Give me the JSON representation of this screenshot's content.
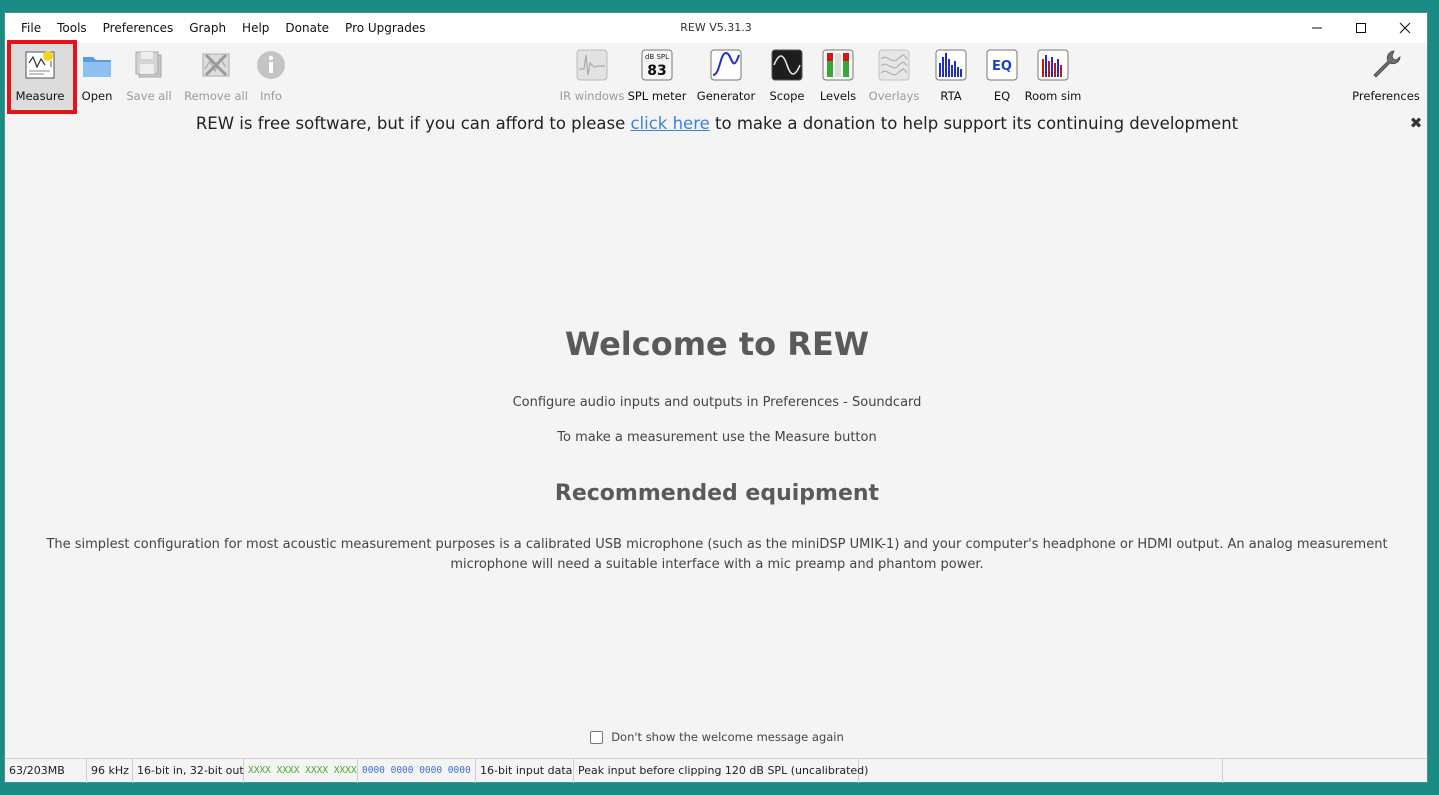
{
  "window": {
    "title": "REW V5.31.3"
  },
  "menu": [
    "File",
    "Tools",
    "Preferences",
    "Graph",
    "Help",
    "Donate",
    "Pro Upgrades"
  ],
  "toolbar": {
    "measure": "Measure",
    "open": "Open",
    "save_all": "Save all",
    "remove_all": "Remove all",
    "info": "Info",
    "ir_windows": "IR windows",
    "spl_meter": "SPL meter",
    "spl_unit": "dB SPL",
    "spl_value": "83",
    "generator": "Generator",
    "scope": "Scope",
    "levels": "Levels",
    "overlays": "Overlays",
    "rta": "RTA",
    "eq": "EQ",
    "eq_icon_text": "EQ",
    "room_sim": "Room sim",
    "preferences": "Preferences"
  },
  "banner": {
    "before": "REW is free software, but if you can afford to please ",
    "link": "click here",
    "after": " to make a donation to help support its continuing development"
  },
  "welcome": {
    "title": "Welcome to REW",
    "line1": "Configure audio inputs and outputs in Preferences - Soundcard",
    "line2": "To make a measurement use the Measure button",
    "rec_title": "Recommended equipment",
    "rec_text": "The simplest configuration for most acoustic measurement purposes is a calibrated USB microphone (such as the miniDSP UMIK-1) and your computer's headphone or HDMI output. An analog measurement microphone will need a suitable interface with a mic preamp and phantom power.",
    "dont_show": "Don't show the welcome message again"
  },
  "status": {
    "memory": "63/203MB",
    "rate": "96 kHz",
    "bits": "16-bit in, 32-bit out",
    "in_levels": "XXXX XXXX  XXXX XXXX",
    "out_levels": "0000 0000  0000 0000",
    "input_data": "16-bit input data",
    "peak": "Peak input before clipping 120 dB SPL (uncalibrated)"
  },
  "colors": {
    "desktop": "#1a8a85",
    "highlight": "#e3131c",
    "link": "#3d7fe0"
  }
}
